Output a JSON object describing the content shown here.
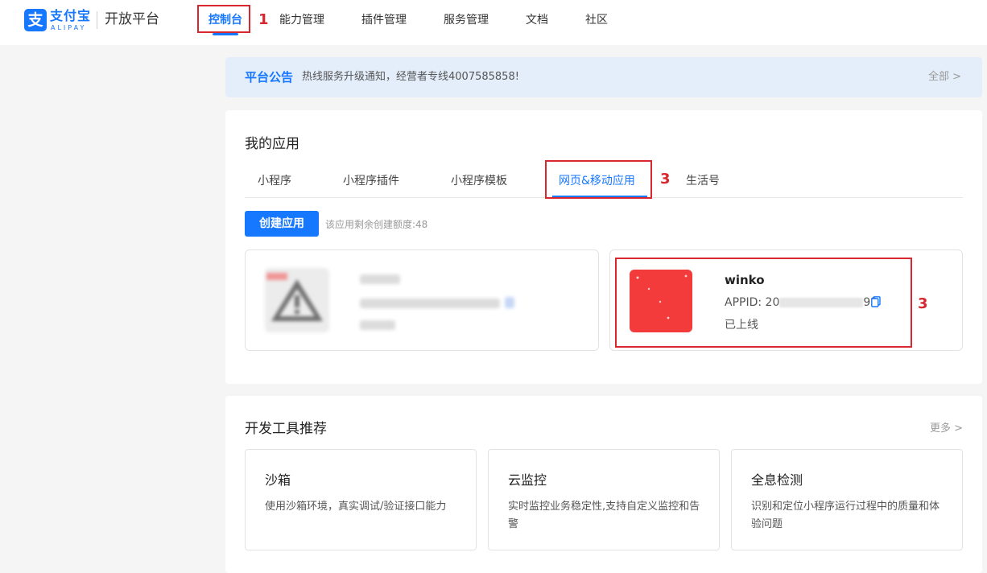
{
  "header": {
    "logo_mark": "支",
    "logo_cn": "支付宝",
    "logo_en": "ALIPAY",
    "platform": "开放平台",
    "nav": [
      "控制台",
      "能力管理",
      "插件管理",
      "服务管理",
      "文档",
      "社区"
    ]
  },
  "annotations": {
    "m1": "1",
    "m2": "3",
    "m3": "3"
  },
  "notice": {
    "title": "平台公告",
    "text": "热线服务升级通知，经营者专线4007585858!",
    "all": "全部 >"
  },
  "apps": {
    "title": "我的应用",
    "tabs": [
      "小程序",
      "小程序插件",
      "小程序模板",
      "网页&移动应用",
      "生活号"
    ],
    "create_btn": "创建应用",
    "quota": "该应用剩余创建额度:48",
    "app": {
      "name": "winko",
      "appid_prefix": "APPID: 20",
      "appid_suffix": "92",
      "status": "已上线"
    }
  },
  "tools": {
    "title": "开发工具推荐",
    "more": "更多 >",
    "items": [
      {
        "title": "沙箱",
        "desc": "使用沙箱环境，真实调试/验证接口能力"
      },
      {
        "title": "云监控",
        "desc": "实时监控业务稳定性,支持自定义监控和告警"
      },
      {
        "title": "全息检测",
        "desc": "识别和定位小程序运行过程中的质量和体验问题"
      }
    ]
  },
  "colors": {
    "primary": "#1677ff",
    "annotation": "#d9272f",
    "app_logo": "#f33b3b"
  }
}
